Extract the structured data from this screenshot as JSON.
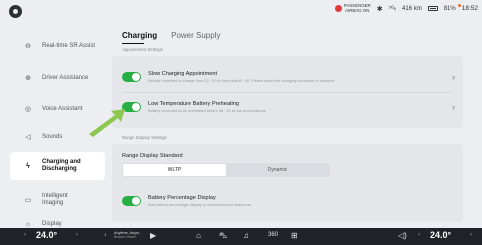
{
  "status": {
    "airbag_line1": "PASSENGER",
    "airbag_line2": "AIRBAG ON",
    "bluetooth_icon": "bluetooth-icon",
    "signal": "⁵ᴳᵢₗ",
    "range": "416 km",
    "battery_percent": "81%",
    "time": "18:52"
  },
  "sidebar": {
    "items": [
      {
        "label": "Real-time SR Assist",
        "icon": "steering-icon"
      },
      {
        "label": "Driver Assistance",
        "icon": "assist-icon"
      },
      {
        "label": "Voice Assistant",
        "icon": "mic-icon"
      },
      {
        "label": "Sounds",
        "icon": "speaker-icon"
      },
      {
        "label": "Charging and Discharging",
        "icon": "plug-icon"
      },
      {
        "label": "Intelligent Imaging",
        "icon": "camera-icon"
      },
      {
        "label": "Display",
        "icon": "sun-icon"
      }
    ],
    "active_index": 4
  },
  "tabs": [
    "Charging",
    "Power Supply"
  ],
  "appointment_settings_label": "Appointment Settings",
  "slow_charging": {
    "title": "Slow Charging Appointment",
    "desc": "Vehicle expected to charge from 22 : 00 to Next day06 : 00. Please insert the charging connector in advance",
    "enabled": true
  },
  "low_temp": {
    "title": "Low Temperature Battery Preheating",
    "desc": "Battery expected to be preheated before 06 : 15 at low temperatures",
    "enabled": true
  },
  "range_display_settings_label": "Range Display Settings",
  "range_display_standard": {
    "title": "Range Display Standard",
    "options": [
      "WLTP",
      "Dynamic"
    ],
    "selected": "WLTP"
  },
  "battery_percentage_display": {
    "title": "Battery Percentage Display",
    "desc": "Add battery percentage display to dashboard and status bar",
    "enabled": true
  },
  "bottom": {
    "left_temp": "24.0°",
    "right_temp": "24.0°",
    "media_title": "Anytime, Anyw..",
    "media_sub": "Bowen Hsieh",
    "play_icon": "play-icon",
    "home_icon": "home-icon",
    "car_icon": "car-icon",
    "music_icon": "music-icon",
    "camera360_label": "360",
    "apps_icon": "apps-icon",
    "volume_icon": "volume-icon",
    "accent_green": "#27ae44",
    "arrow_green": "#8cc850"
  }
}
